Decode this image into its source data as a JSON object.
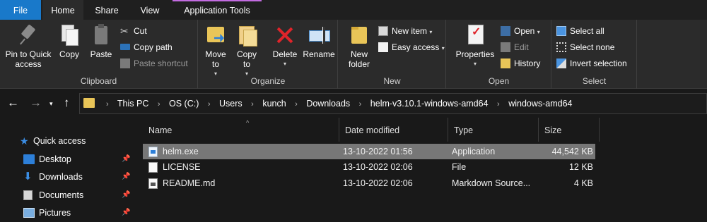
{
  "tabs": {
    "file": "File",
    "home": "Home",
    "share": "Share",
    "view": "View",
    "app_tools": "Application Tools"
  },
  "ribbon": {
    "clipboard": {
      "label": "Clipboard",
      "pin": "Pin to Quick access",
      "copy": "Copy",
      "paste": "Paste",
      "cut": "Cut",
      "copy_path": "Copy path",
      "paste_shortcut": "Paste shortcut"
    },
    "organize": {
      "label": "Organize",
      "move_to": "Move to",
      "copy_to": "Copy to",
      "delete": "Delete",
      "rename": "Rename"
    },
    "new": {
      "label": "New",
      "new_folder": "New folder",
      "new_item": "New item",
      "easy_access": "Easy access"
    },
    "open": {
      "label": "Open",
      "properties": "Properties",
      "open": "Open",
      "edit": "Edit",
      "history": "History"
    },
    "select": {
      "label": "Select",
      "select_all": "Select all",
      "select_none": "Select none",
      "invert_selection": "Invert selection"
    }
  },
  "breadcrumb": [
    "This PC",
    "OS (C:)",
    "Users",
    "kunch",
    "Downloads",
    "helm-v3.10.1-windows-amd64",
    "windows-amd64"
  ],
  "navpane": {
    "quick_access": "Quick access",
    "items": [
      "Desktop",
      "Downloads",
      "Documents",
      "Pictures"
    ]
  },
  "columns": {
    "name": "Name",
    "date_modified": "Date modified",
    "type": "Type",
    "size": "Size"
  },
  "files": [
    {
      "name": "helm.exe",
      "date": "13-10-2022 01:56",
      "type": "Application",
      "size": "44,542 KB",
      "icon": "app-icon"
    },
    {
      "name": "LICENSE",
      "date": "13-10-2022 02:06",
      "type": "File",
      "size": "12 KB",
      "icon": "file-icon"
    },
    {
      "name": "README.md",
      "date": "13-10-2022 02:06",
      "type": "Markdown Source...",
      "size": "4 KB",
      "icon": "markdown-icon"
    }
  ],
  "icons": {
    "back": "←",
    "forward": "→",
    "recent": "▾",
    "up": "↑",
    "pin": "📌",
    "star": "★",
    "download": "⬇",
    "sort_up": "^",
    "dropdown": "▾"
  }
}
